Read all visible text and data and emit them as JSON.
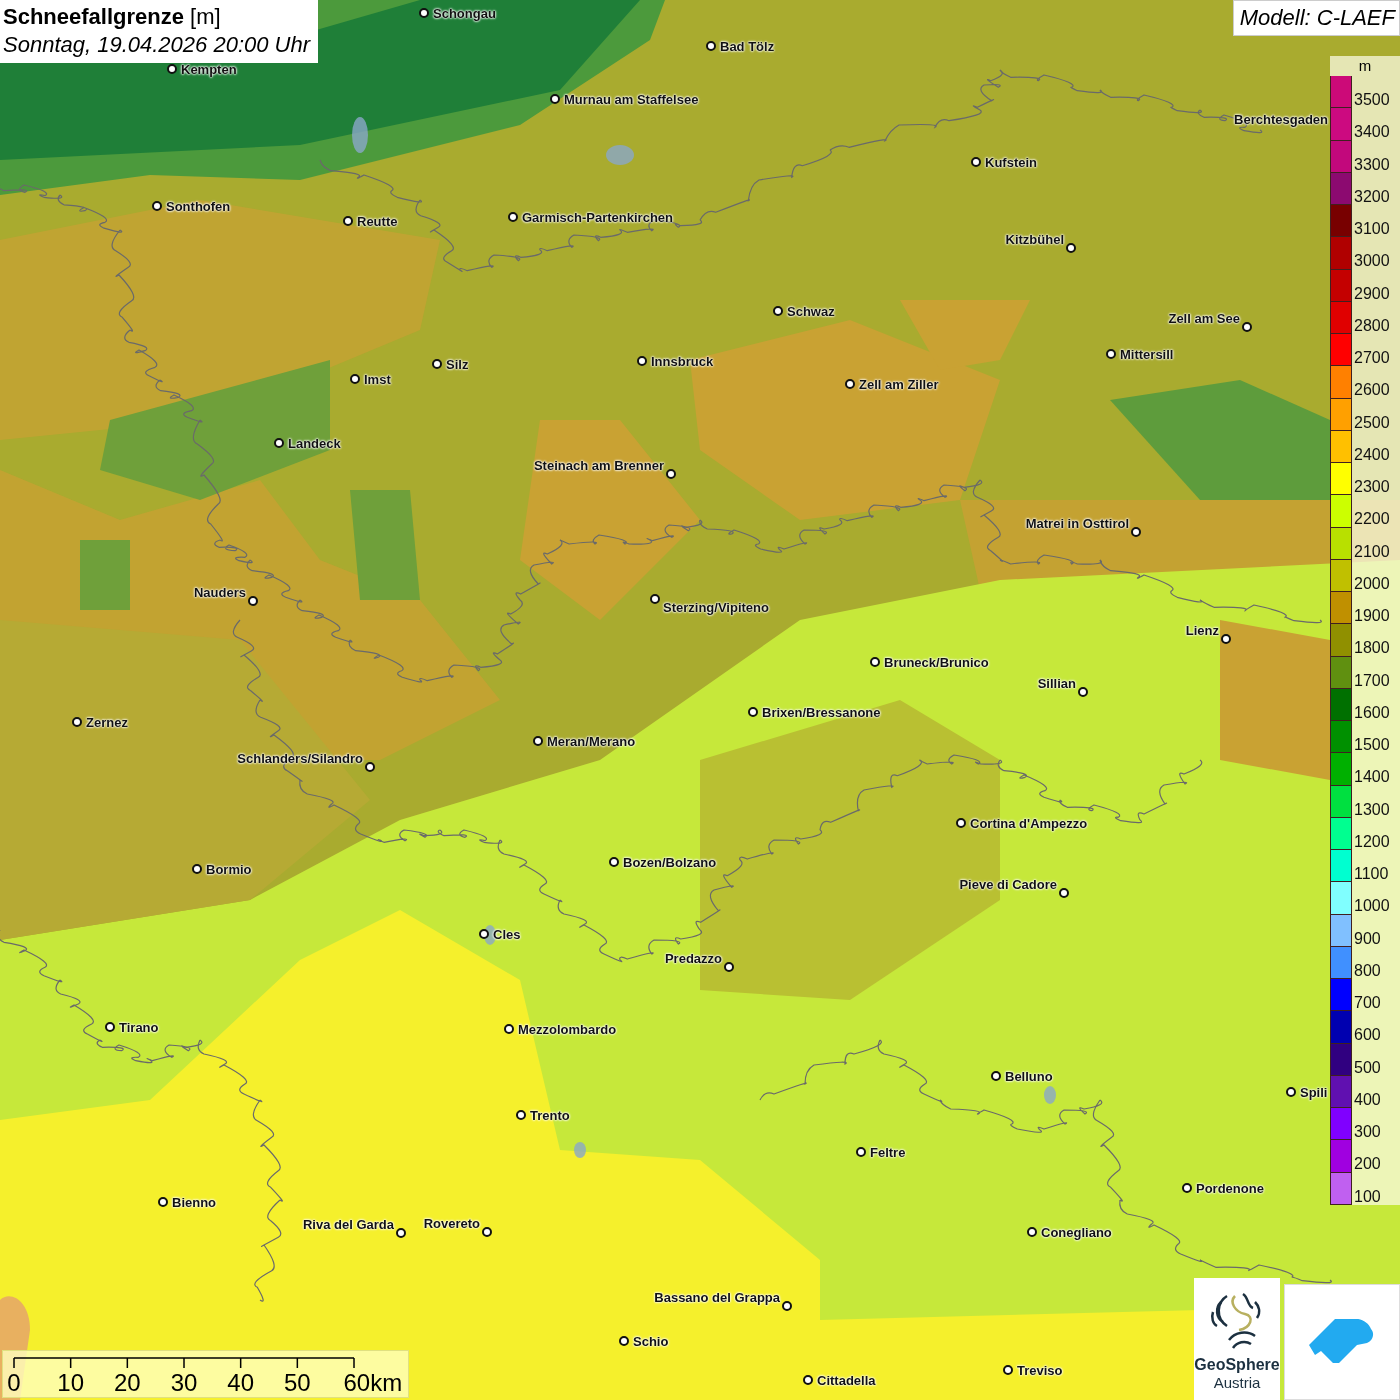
{
  "title": {
    "heading": "**Schneefallgrenze** [m]",
    "subtitle": "Sonntag, 19.04.2026 20:00 Uhr"
  },
  "model": "Modell: C-LAEF",
  "places": [
    {
      "name": "Schongau",
      "kind": "town"
    },
    {
      "name": "Bad Tölz",
      "kind": "town"
    },
    {
      "name": "Kempten",
      "kind": "town"
    },
    {
      "name": "Murnau am Staffelsee",
      "kind": "town"
    },
    {
      "name": "Berchtesgaden",
      "kind": "label"
    },
    {
      "name": "Kufstein",
      "kind": "town"
    },
    {
      "name": "Sonthofen",
      "kind": "town"
    },
    {
      "name": "Reutte",
      "kind": "town"
    },
    {
      "name": "Garmisch-Partenkirchen",
      "kind": "town"
    },
    {
      "name": "Kitzbühel",
      "kind": "town"
    },
    {
      "name": "Schwaz",
      "kind": "town"
    },
    {
      "name": "Zell am See",
      "kind": "town"
    },
    {
      "name": "Innsbruck",
      "kind": "town"
    },
    {
      "name": "Mittersill",
      "kind": "town"
    },
    {
      "name": "Silz",
      "kind": "town"
    },
    {
      "name": "Imst",
      "kind": "town"
    },
    {
      "name": "Zell am Ziller",
      "kind": "town"
    },
    {
      "name": "Landeck",
      "kind": "town"
    },
    {
      "name": "Steinach am Brenner",
      "kind": "town"
    },
    {
      "name": "Matrei in Osttirol",
      "kind": "town"
    },
    {
      "name": "Nauders",
      "kind": "town"
    },
    {
      "name": "Sterzing/Vipiteno",
      "kind": "town"
    },
    {
      "name": "Lienz",
      "kind": "town"
    },
    {
      "name": "Bruneck/Brunico",
      "kind": "town"
    },
    {
      "name": "Sillian",
      "kind": "town"
    },
    {
      "name": "Brixen/Bressanone",
      "kind": "town"
    },
    {
      "name": "Zernez",
      "kind": "town"
    },
    {
      "name": "Meran/Merano",
      "kind": "town"
    },
    {
      "name": "Schlanders/Silandro",
      "kind": "town"
    },
    {
      "name": "Cortina d'Ampezzo",
      "kind": "town"
    },
    {
      "name": "Bozen/Bolzano",
      "kind": "town"
    },
    {
      "name": "Bormio",
      "kind": "town"
    },
    {
      "name": "Pieve di Cadore",
      "kind": "town"
    },
    {
      "name": "Cles",
      "kind": "town"
    },
    {
      "name": "Predazzo",
      "kind": "town"
    },
    {
      "name": "Tirano",
      "kind": "town"
    },
    {
      "name": "Mezzolombardo",
      "kind": "town"
    },
    {
      "name": "Belluno",
      "kind": "town"
    },
    {
      "name": "Spili",
      "kind": "town"
    },
    {
      "name": "Trento",
      "kind": "town"
    },
    {
      "name": "Feltre",
      "kind": "town"
    },
    {
      "name": "Pordenone",
      "kind": "town"
    },
    {
      "name": "Bienno",
      "kind": "town"
    },
    {
      "name": "Riva del Garda",
      "kind": "town"
    },
    {
      "name": "Rovereto",
      "kind": "town"
    },
    {
      "name": "Conegliano",
      "kind": "town"
    },
    {
      "name": "Bassano del Grappa",
      "kind": "town"
    },
    {
      "name": "Schio",
      "kind": "town"
    },
    {
      "name": "Treviso",
      "kind": "town"
    },
    {
      "name": "Cittadella",
      "kind": "town"
    }
  ],
  "legend": {
    "unit": "m",
    "bands": [
      {
        "label": "3500",
        "color": "#cc0a78"
      },
      {
        "label": "3400",
        "color": "#cc0a80"
      },
      {
        "label": "3300",
        "color": "#c2087c"
      },
      {
        "label": "3200",
        "color": "#8c0a70"
      },
      {
        "label": "3100",
        "color": "#780000"
      },
      {
        "label": "3000",
        "color": "#b00000"
      },
      {
        "label": "2900",
        "color": "#c40000"
      },
      {
        "label": "2800",
        "color": "#e00000"
      },
      {
        "label": "2700",
        "color": "#ff0000"
      },
      {
        "label": "2600",
        "color": "#ff8000"
      },
      {
        "label": "2500",
        "color": "#ffa000"
      },
      {
        "label": "2400",
        "color": "#ffc000"
      },
      {
        "label": "2300",
        "color": "#ffff00"
      },
      {
        "label": "2200",
        "color": "#ccff00"
      },
      {
        "label": "2100",
        "color": "#b8e000"
      },
      {
        "label": "2000",
        "color": "#c0c000"
      },
      {
        "label": "1900",
        "color": "#c09000"
      },
      {
        "label": "1800",
        "color": "#909000"
      },
      {
        "label": "1700",
        "color": "#609010"
      },
      {
        "label": "1600",
        "color": "#007000"
      },
      {
        "label": "1500",
        "color": "#009000"
      },
      {
        "label": "1400",
        "color": "#00b000"
      },
      {
        "label": "1300",
        "color": "#00e040"
      },
      {
        "label": "1200",
        "color": "#00ff90"
      },
      {
        "label": "1100",
        "color": "#00ffd0"
      },
      {
        "label": "1000",
        "color": "#80ffff"
      },
      {
        "label": "900",
        "color": "#80c0ff"
      },
      {
        "label": "800",
        "color": "#4090ff"
      },
      {
        "label": "700",
        "color": "#0000ff"
      },
      {
        "label": "600",
        "color": "#0000b0"
      },
      {
        "label": "500",
        "color": "#300080"
      },
      {
        "label": "400",
        "color": "#6010b0"
      },
      {
        "label": "300",
        "color": "#8000ff"
      },
      {
        "label": "200",
        "color": "#a000e0"
      },
      {
        "label": "100",
        "color": "#c060f0"
      }
    ]
  },
  "scale": {
    "labels": [
      "0",
      "10",
      "20",
      "30",
      "40",
      "50",
      "60km"
    ]
  },
  "logo": {
    "name": "GeoSphere",
    "sub": "Austria"
  }
}
